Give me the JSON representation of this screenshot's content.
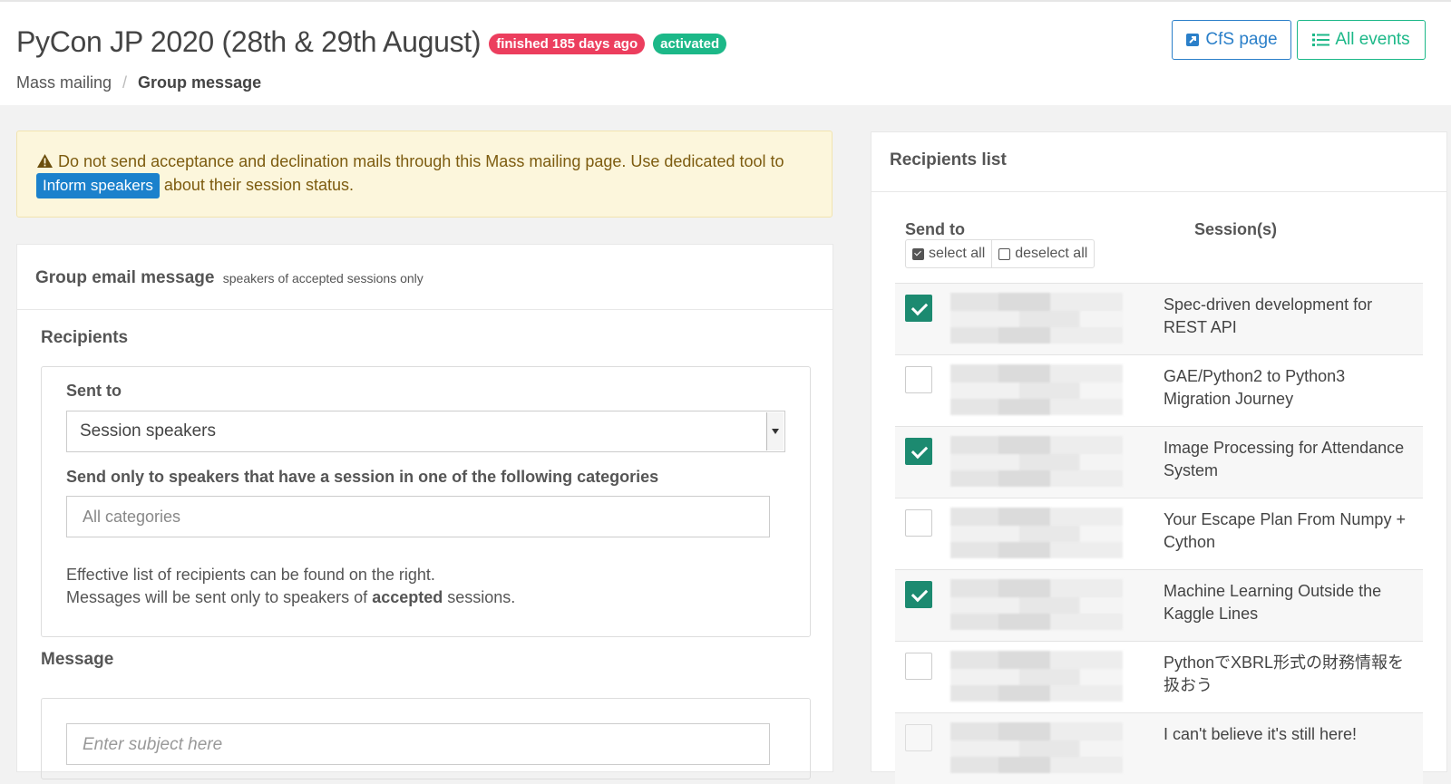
{
  "header": {
    "title": "PyCon JP 2020 (28th & 29th August)",
    "badge_finished": "finished 185 days ago",
    "badge_activated": "activated",
    "breadcrumb": {
      "parent": "Mass mailing",
      "separator": "/",
      "current": "Group message"
    },
    "cfs_button": "CfS page",
    "events_button": "All events",
    "colors": {
      "danger": "#ec3e5e",
      "success": "#1cb888",
      "primary": "#2a7fc9"
    }
  },
  "warning": {
    "icon": "warning-triangle-icon",
    "text_before": "Do not send acceptance and declination mails through this Mass mailing page. Use dedicated tool to",
    "tag": "Inform speakers",
    "text_after": "about their session status."
  },
  "group_card": {
    "title": "Group email message",
    "subtitle": "speakers of accepted sessions only",
    "recipients_label": "Recipients",
    "sent_to_label": "Sent to",
    "sent_to_value": "Session speakers",
    "categories_label": "Send only to speakers that have a session in one of the following categories",
    "categories_placeholder": "All categories",
    "note_line1": "Effective list of recipients can be found on the right.",
    "note_line2_before": "Messages will be sent only to speakers of",
    "note_line2_bold": "accepted",
    "note_line2_after": "sessions.",
    "message_label": "Message",
    "subject_placeholder": "Enter subject here"
  },
  "recipients_panel": {
    "title": "Recipients list",
    "col_send_to": "Send to",
    "col_sessions": "Session(s)",
    "select_all": "select all",
    "deselect_all": "deselect all",
    "rows": [
      {
        "checked": true,
        "session": "Spec-driven development for REST API"
      },
      {
        "checked": false,
        "session": "GAE/Python2 to Python3 Migration Journey"
      },
      {
        "checked": true,
        "session": "Image Processing for Attendance System"
      },
      {
        "checked": false,
        "session": "Your Escape Plan From Numpy + Cython"
      },
      {
        "checked": true,
        "session": "Machine Learning Outside the Kaggle Lines"
      },
      {
        "checked": false,
        "session": "PythonでXBRL形式の財務情報を扱おう"
      },
      {
        "checked": false,
        "session": "I can't believe it's still here!"
      }
    ]
  }
}
